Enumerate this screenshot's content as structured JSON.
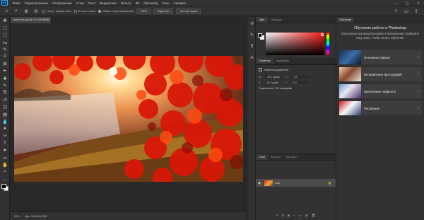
{
  "menubar": {
    "logo": "Ps",
    "items": [
      "Файл",
      "Редактирование",
      "Изображение",
      "Слои",
      "Текст",
      "Выделение",
      "Фильтр",
      "3D",
      "Просмотр",
      "Окно",
      "Справка"
    ],
    "window_controls": {
      "minimize": "—",
      "maximize": "▢",
      "close": "✕"
    }
  },
  "optionsbar": {
    "zoom_in_icon": "zoom-in-icon",
    "zoom_out_icon": "zoom-out-icon",
    "resize_windows": "Настр. размер окон",
    "all_windows": "Во всех окнах",
    "scrubby_zoom": "Масшт. перетаскиванием",
    "scrubby_checked": true,
    "zoom_100": "100%",
    "fit_screen": "Подогнать",
    "fill_screen": "Полный экран"
  },
  "toolbar": {
    "tools": [
      "move-tool",
      "artboard-tool",
      "marquee-tool",
      "lasso-tool",
      "quick-select-tool",
      "crop-tool",
      "frame-tool",
      "eyedropper-tool",
      "healing-brush-tool",
      "brush-tool",
      "clone-stamp-tool",
      "history-brush-tool",
      "eraser-tool",
      "gradient-tool",
      "blur-tool",
      "dodge-tool",
      "pen-tool",
      "type-tool",
      "path-select-tool",
      "rectangle-tool",
      "hand-tool",
      "zoom-tool",
      "more-tools"
    ],
    "glyphs": [
      "✥",
      "⬚",
      "⬚",
      "ᔓ",
      "✎",
      "⌗",
      "⊞",
      "✒",
      "✚",
      "✎",
      "⎘",
      "↺",
      "◫",
      "▤",
      "💧",
      "●",
      "✑",
      "T",
      "➤",
      "▭",
      "✋",
      "⌕",
      "…"
    ],
    "foreground_color": "#000000",
    "background_color": "#ffffff"
  },
  "document": {
    "tab_title": "dadsa.eee.jpg @ 33% (RGB/8#)",
    "status_zoom": "33%",
    "status_doc": "Док: 5,93M/5,93M"
  },
  "panels": {
    "color_tabs": [
      "Цвет",
      "Образцы"
    ],
    "props_tabs": [
      "Свойства",
      "Коррекция"
    ],
    "props_heading": "Свойства документа",
    "props_rows": [
      {
        "l1": "Ш:",
        "v1": "32,1 дюйм",
        "l2": "X:",
        "v2": "0,0"
      },
      {
        "l1": "В:",
        "v1": "16,9 дюйм",
        "l2": "Y:",
        "v2": "0,0"
      }
    ],
    "resolution": "Разрешение: 100 пикс/дюйм",
    "layers_tabs": [
      "Слои",
      "Каналы",
      "Контуры"
    ],
    "layer_name": "Фон",
    "layer_footer_icons": [
      "link-icon",
      "fx-icon",
      "mask-icon",
      "adjustment-icon",
      "folder-icon",
      "new-layer-icon",
      "trash-icon"
    ]
  },
  "learn": {
    "title": "Обучение работе в Photoshop",
    "subtitle": "Пошаговые руководства прямо в приложении. Выберите тему ниже, чтобы начать обучение.",
    "cards": [
      {
        "label": "Основные навыки"
      },
      {
        "label": "Исправление фотографий"
      },
      {
        "label": "Креативные эффекты"
      },
      {
        "label": "Рисование"
      }
    ]
  },
  "colors": {
    "accent": "#31a8ff",
    "panel_bg": "#323232",
    "canvas_bg": "#282828"
  }
}
